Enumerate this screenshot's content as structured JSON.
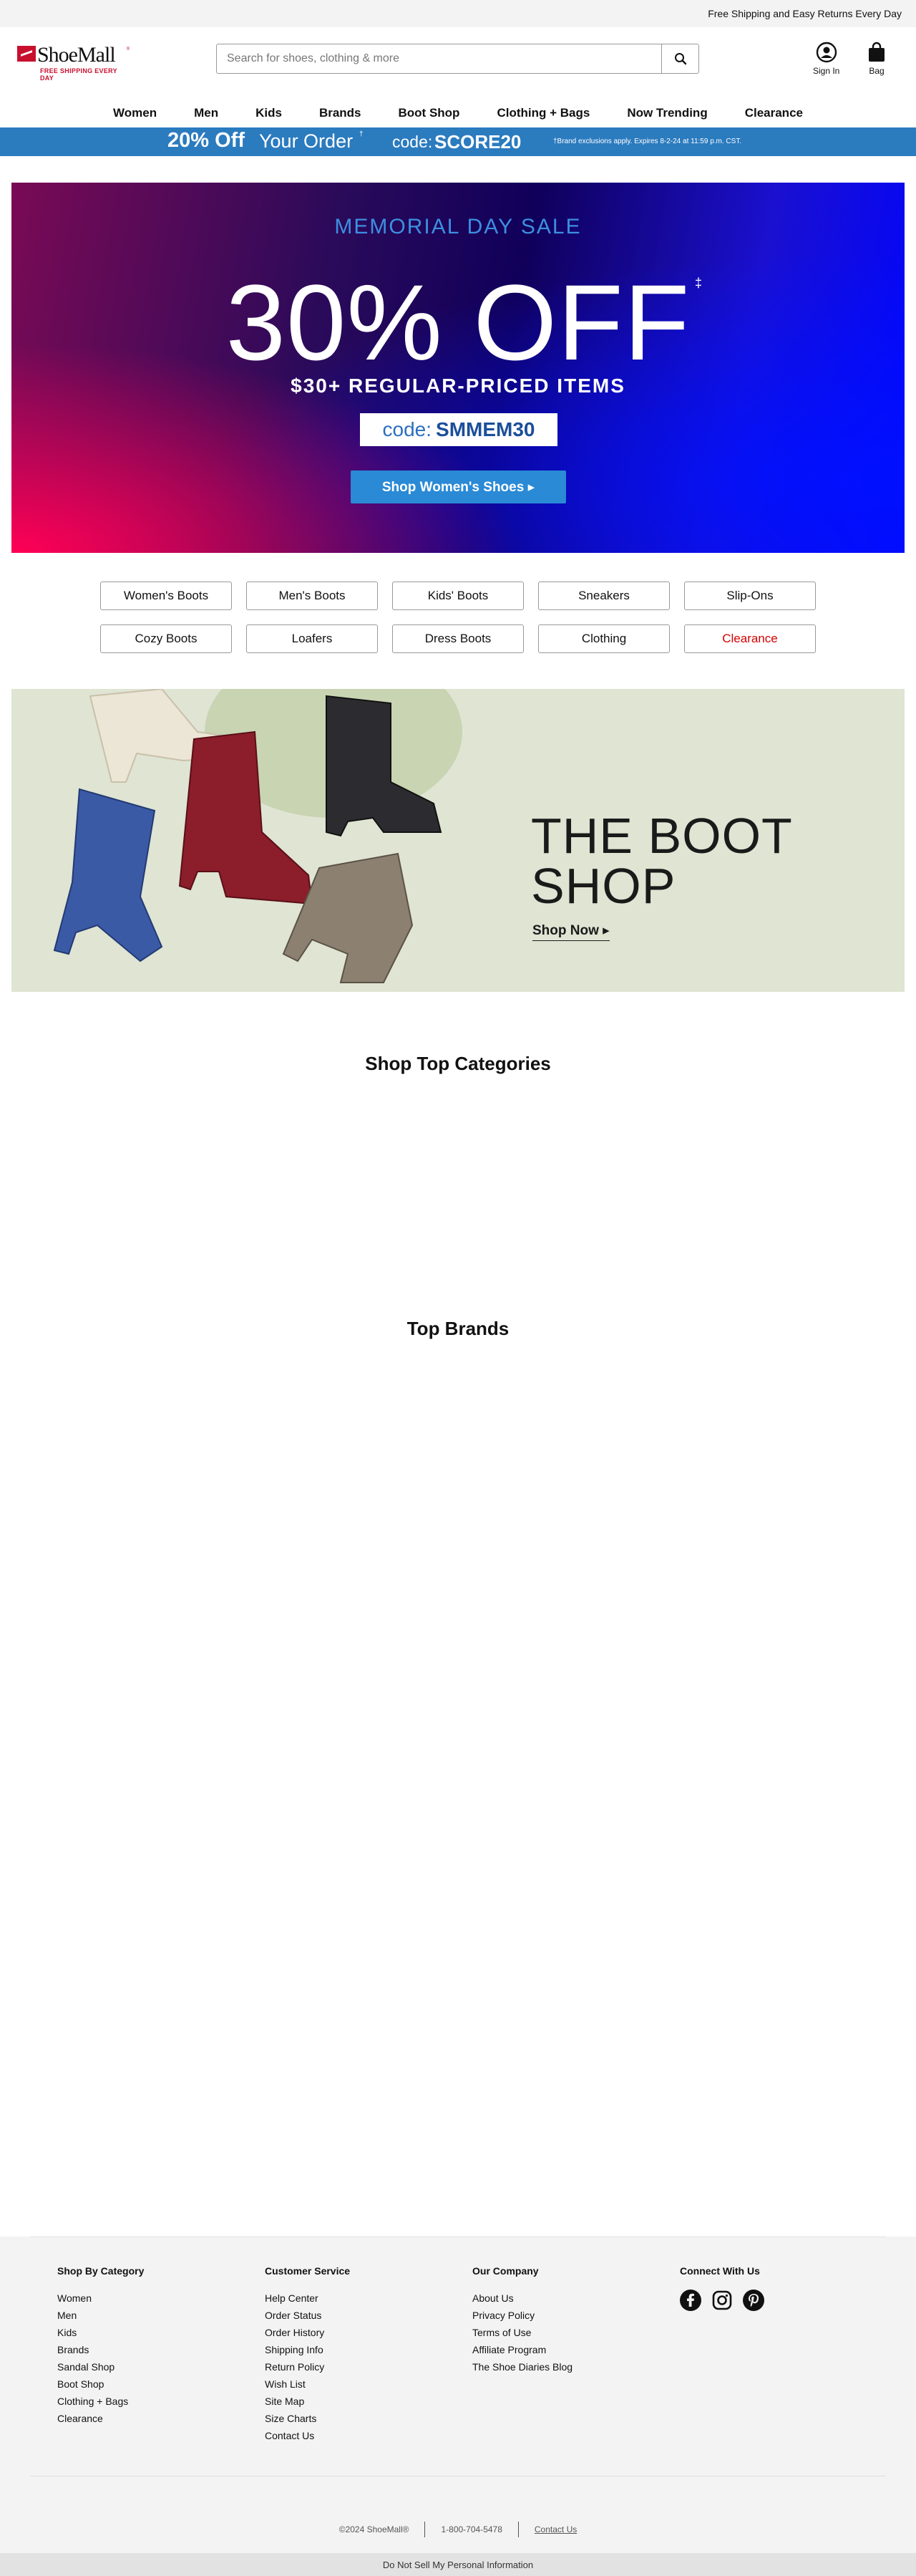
{
  "top_strip": {
    "text": "Free Shipping and Easy Returns Every Day"
  },
  "header": {
    "logo_text": "ShoeMall",
    "logo_tm": "®",
    "logo_tagline": "FREE SHIPPING EVERY DAY",
    "search_placeholder": "Search for shoes, clothing & more",
    "search_icon": "magnifier-icon",
    "sign_in_label": "Sign In",
    "bag_label": "Bag"
  },
  "nav": {
    "items": [
      "Women",
      "Men",
      "Kids",
      "Brands",
      "Boot Shop",
      "Clothing + Bags",
      "Now Trending",
      "Clearance"
    ]
  },
  "promo_band": {
    "headline_bold": "20% Off",
    "headline_rest": "Your Order",
    "sup": "†",
    "code_label": "code:",
    "code": "SCORE20",
    "fine_print": "†Brand exclusions apply. Expires 8-2-24 at 11:59 p.m. CST."
  },
  "hero": {
    "eyebrow": "MEMORIAL DAY SALE",
    "headline": "30% OFF",
    "dagger": "‡",
    "subhead": "$30+ REGULAR-PRICED ITEMS",
    "code_label": "code:",
    "code": "SMMEM30",
    "cta": "Shop Women's Shoes ▸"
  },
  "categories": [
    {
      "label": "Women's Boots",
      "highlight": false
    },
    {
      "label": "Men's Boots",
      "highlight": false
    },
    {
      "label": "Kids' Boots",
      "highlight": false
    },
    {
      "label": "Sneakers",
      "highlight": false
    },
    {
      "label": "Slip-Ons",
      "highlight": false
    },
    {
      "label": "Cozy Boots",
      "highlight": false
    },
    {
      "label": "Loafers",
      "highlight": false
    },
    {
      "label": "Dress Boots",
      "highlight": false
    },
    {
      "label": "Clothing",
      "highlight": false
    },
    {
      "label": "Clearance",
      "highlight": true
    }
  ],
  "boot_banner": {
    "title_line1": "THE BOOT",
    "title_line2": "SHOP",
    "cta": "Shop Now ▸"
  },
  "sections": {
    "top_categories": "Shop Top Categories",
    "top_brands": "Top Brands"
  },
  "footer": {
    "columns": [
      {
        "title": "Shop By Category",
        "links": [
          "Women",
          "Men",
          "Kids",
          "Brands",
          "Sandal Shop",
          "Boot Shop",
          "Clothing + Bags",
          "Clearance"
        ]
      },
      {
        "title": "Customer Service",
        "links": [
          "Help Center",
          "Order Status",
          "Order History",
          "Shipping Info",
          "Return Policy",
          "Wish List",
          "Site Map",
          "Size Charts",
          "Contact Us"
        ]
      },
      {
        "title": "Our Company",
        "links": [
          "About Us",
          "Privacy Policy",
          "Terms of Use",
          "Affiliate Program",
          "The Shoe Diaries Blog"
        ]
      }
    ],
    "connect_title": "Connect With Us",
    "social_icons": [
      "facebook-icon",
      "instagram-icon",
      "pinterest-icon"
    ],
    "copyright": "©2024 ShoeMall®",
    "phone": "1-800-704-5478",
    "contact_link": "Contact Us",
    "ccpa": "Do Not Sell My Personal Information"
  },
  "colors": {
    "promo_band": "#2b7bbf",
    "brand_red": "#c8102e",
    "clearance_red": "#d40000",
    "hero_cta": "#2a8ad6",
    "footer_bg": "#f3f3f3"
  }
}
